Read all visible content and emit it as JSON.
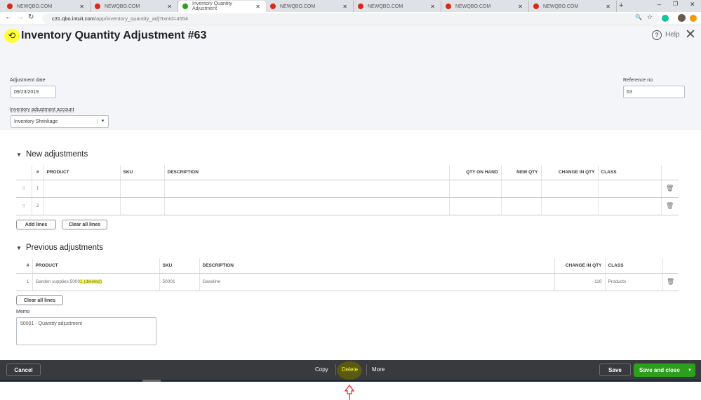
{
  "browser": {
    "tabs": [
      {
        "title": "NEWQBO.COM"
      },
      {
        "title": "NEWQBO.COM"
      },
      {
        "title": "Inventory Quantity Adjustment",
        "active": true
      },
      {
        "title": "NEWQBO.COM"
      },
      {
        "title": "NEWQBO.COM"
      },
      {
        "title": "NEWQBO.COM"
      },
      {
        "title": "NEWQBO.COM"
      }
    ],
    "url_host": "c31.qbo.intuit.com",
    "url_path": "/app/inventory_quantity_adj?txnId=4554"
  },
  "header": {
    "title": "Inventory Quantity Adjustment #63",
    "help": "Help"
  },
  "form": {
    "date_label": "Adjustment date",
    "date_value": "09/23/2019",
    "account_label": "Inventory adjustment account",
    "account_value": "Inventory Shrinkage",
    "ref_label": "Reference no.",
    "ref_value": "63"
  },
  "new_adj": {
    "title": "New adjustments",
    "columns": [
      "#",
      "PRODUCT",
      "SKU",
      "DESCRIPTION",
      "QTY ON HAND",
      "NEW QTY",
      "CHANGE IN QTY",
      "CLASS"
    ],
    "rows": [
      {
        "n": "1"
      },
      {
        "n": "2"
      }
    ],
    "add_lines": "Add lines",
    "clear_lines": "Clear all lines"
  },
  "prev_adj": {
    "title": "Previous adjustments",
    "columns": [
      "#",
      "PRODUCT",
      "SKU",
      "DESCRIPTION",
      "CHANGE IN QTY",
      "CLASS"
    ],
    "rows": [
      {
        "n": "1",
        "product": "Garden supplies:5000",
        "product_hl": "1 (deleted)",
        "sku": "50001",
        "description": "Gasoline",
        "change": "-110",
        "class": "Products"
      }
    ],
    "clear_lines": "Clear all lines"
  },
  "memo": {
    "label": "Memo",
    "value": "50001 - Quantity adjustment"
  },
  "footer": {
    "cancel": "Cancel",
    "copy": "Copy",
    "delete": "Delete",
    "more": "More",
    "save": "Save",
    "save_close": "Save and close"
  },
  "colors": {
    "green": "#2ca01c",
    "footer": "#393a3d",
    "highlight": "#ffff33"
  }
}
